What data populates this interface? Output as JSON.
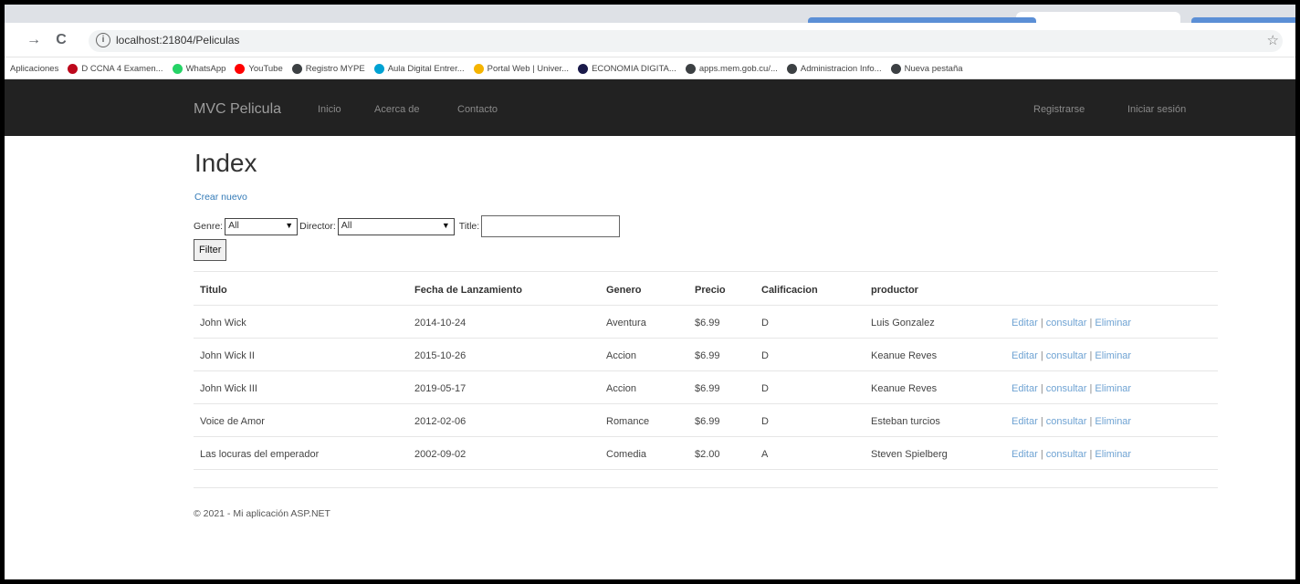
{
  "browser": {
    "url": "localhost:21804/Peliculas",
    "bookmarks": [
      {
        "label": "Aplicaciones",
        "icon": "apps-icon",
        "color": ""
      },
      {
        "label": "D CCNA 4 Examen...",
        "icon": "pinterest-icon",
        "color": "#bd081c"
      },
      {
        "label": "WhatsApp",
        "icon": "whatsapp-icon",
        "color": "#25d366"
      },
      {
        "label": "YouTube",
        "icon": "youtube-icon",
        "color": "#ff0000"
      },
      {
        "label": "Registro MYPE",
        "icon": "globe-icon",
        "color": "#3c4043"
      },
      {
        "label": "Aula Digital Entrer...",
        "icon": "aula-icon",
        "color": "#00a2d3"
      },
      {
        "label": "Portal Web | Univer...",
        "icon": "portal-icon",
        "color": "#f5b400"
      },
      {
        "label": "ECONOMIA DIGITA...",
        "icon": "economia-icon",
        "color": "#1a1a4a"
      },
      {
        "label": "apps.mem.gob.cu/...",
        "icon": "globe-icon",
        "color": "#3c4043"
      },
      {
        "label": "Administracion Info...",
        "icon": "globe-icon",
        "color": "#3c4043"
      },
      {
        "label": "Nueva pestaña",
        "icon": "globe-icon",
        "color": "#3c4043"
      }
    ]
  },
  "navbar": {
    "brand": "MVC Pelicula",
    "links": [
      "Inicio",
      "Acerca de",
      "Contacto"
    ],
    "register": "Registrarse",
    "login": "Iniciar sesión"
  },
  "page": {
    "title": "Index",
    "create_link": "Crear nuevo"
  },
  "filter": {
    "genre_label": "Genre:",
    "genre_value": "All",
    "director_label": "Director:",
    "director_value": "All",
    "title_label": "Title:",
    "title_value": "",
    "button": "Filter"
  },
  "table": {
    "headers": [
      "Titulo",
      "Fecha de Lanzamiento",
      "Genero",
      "Precio",
      "Calificacion",
      "productor"
    ],
    "rows": [
      [
        "John Wick",
        "2014-10-24",
        "Aventura",
        "$6.99",
        "D",
        "Luis Gonzalez"
      ],
      [
        "John Wick II",
        "2015-10-26",
        "Accion",
        "$6.99",
        "D",
        "Keanue Reves"
      ],
      [
        "John Wick III",
        "2019-05-17",
        "Accion",
        "$6.99",
        "D",
        "Keanue Reves"
      ],
      [
        "Voice de Amor",
        "2012-02-06",
        "Romance",
        "$6.99",
        "D",
        "Esteban turcios"
      ],
      [
        "Las locuras del emperador",
        "2002-09-02",
        "Comedia",
        "$2.00",
        "A",
        "Steven Spielberg"
      ]
    ],
    "actions": {
      "edit": "Editar",
      "details": "consultar",
      "delete": "Eliminar",
      "separator": "|"
    }
  },
  "footer": {
    "text": "© 2021 - Mi aplicación ASP.NET"
  }
}
